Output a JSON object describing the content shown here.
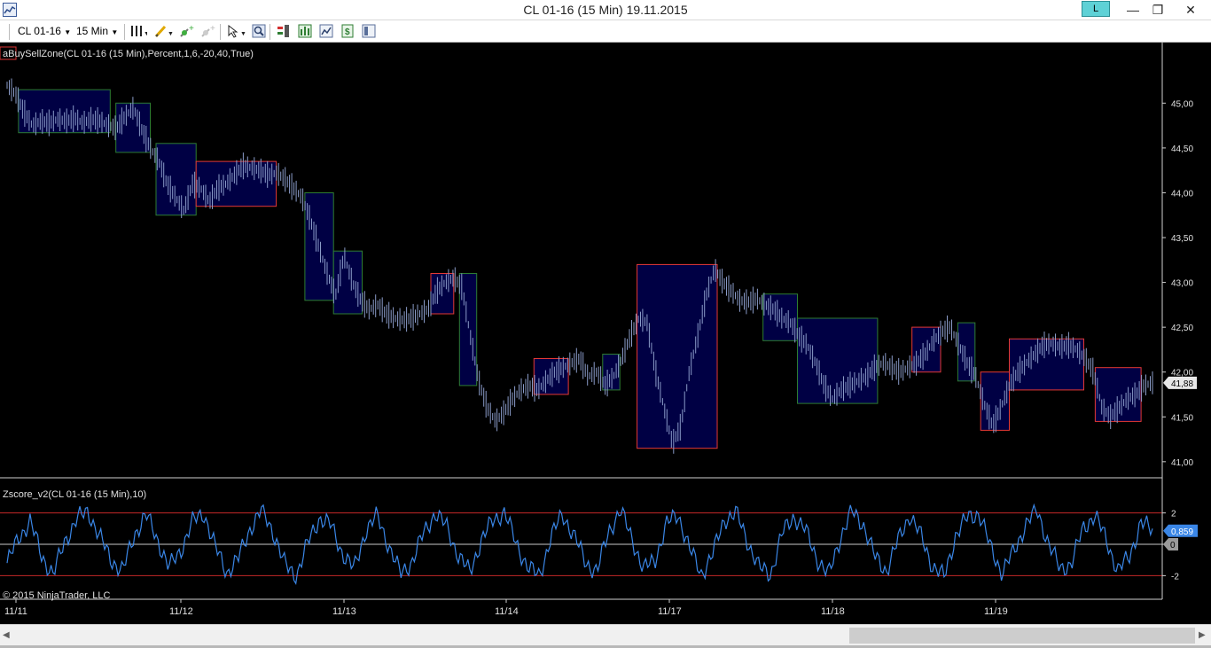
{
  "window": {
    "title": "CL 01-16 (15 Min)  19.11.2015",
    "link_label": "L",
    "minimize": "—",
    "maximize": "❐",
    "close": "✕"
  },
  "toolbar": {
    "instrument": "CL 01-16",
    "period": "15 Min",
    "icons": [
      "bar-style-icon",
      "draw-pencil-icon",
      "add-indicator-icon",
      "strategy-icon",
      "cursor-icon",
      "zoom-icon",
      "chart-trader-icon",
      "data-box-icon",
      "template-icon",
      "order-icon",
      "properties-icon"
    ]
  },
  "chart": {
    "indicator_label": "aBuySellZone(CL 01-16 (15 Min),Percent,1,6,-20,40,True)",
    "oscillator_label": "Zscore_v2(CL 01-16 (15 Min),10)",
    "copyright": "© 2015 NinjaTrader, LLC",
    "colors": {
      "background": "#000000",
      "price_bars": "#8a9bc8",
      "buy_zone": "#2e7d32",
      "sell_zone": "#e53935",
      "zone_fill": "#000050",
      "zscore_line": "#3a86e6",
      "bands": "#c62828"
    }
  },
  "chart_data": [
    {
      "type": "line",
      "title": "",
      "ylim": [
        40.85,
        45.3
      ],
      "y_ticks": [
        "45,00",
        "44,50",
        "44,00",
        "43,50",
        "43,00",
        "42,50",
        "42,00",
        "41,50",
        "41,00"
      ],
      "x_ticks": [
        "11/11",
        "11/12",
        "11/13",
        "11/14",
        "11/17",
        "11/18",
        "11/19"
      ],
      "last_price_label": "41,88",
      "series": [
        {
          "values": [
            45.2,
            45.1,
            44.9,
            44.75,
            44.8,
            44.78,
            44.82,
            44.8,
            44.83,
            44.78,
            44.82,
            44.8,
            44.75,
            44.72,
            44.85,
            44.95,
            44.7,
            44.5,
            44.35,
            44.1,
            43.95,
            43.8,
            44.1,
            44.05,
            43.9,
            44.05,
            44.1,
            44.2,
            44.3,
            44.28,
            44.25,
            44.2,
            44.22,
            44.15,
            44.05,
            43.95,
            43.7,
            43.4,
            43.1,
            42.85,
            43.3,
            43.0,
            42.8,
            42.7,
            42.75,
            42.65,
            42.6,
            42.58,
            42.6,
            42.65,
            42.7,
            42.9,
            43.0,
            43.05,
            42.95,
            42.4,
            41.9,
            41.6,
            41.45,
            41.55,
            41.7,
            41.8,
            41.85,
            41.8,
            41.9,
            42.0,
            42.05,
            42.1,
            42.15,
            41.95,
            42.0,
            41.85,
            41.95,
            42.15,
            42.4,
            42.6,
            42.55,
            42.0,
            41.6,
            41.2,
            41.4,
            42.0,
            42.4,
            42.85,
            43.15,
            43.0,
            42.9,
            42.8,
            42.78,
            42.82,
            42.75,
            42.7,
            42.6,
            42.55,
            42.4,
            42.3,
            42.1,
            41.85,
            41.7,
            41.8,
            41.85,
            41.9,
            41.95,
            42.05,
            42.1,
            42.05,
            42.0,
            42.05,
            42.1,
            42.2,
            42.35,
            42.45,
            42.5,
            42.3,
            42.1,
            41.95,
            41.65,
            41.4,
            41.6,
            41.85,
            42.0,
            42.1,
            42.2,
            42.3,
            42.32,
            42.28,
            42.3,
            42.25,
            42.15,
            42.0,
            41.6,
            41.5,
            41.6,
            41.7,
            41.75,
            41.85,
            41.88
          ]
        }
      ]
    },
    {
      "type": "line",
      "title": "",
      "ylim": [
        -2.6,
        2.6
      ],
      "y_ticks": [
        "2",
        "0",
        "-2"
      ],
      "bands": [
        2,
        0,
        -2
      ],
      "last_value_label": "0,859",
      "zero_label": "0",
      "series": [
        {
          "values": [
            -1.2,
            0.4,
            1.5,
            -0.8,
            -1.9,
            0.2,
            1.6,
            2.1,
            0.5,
            -1.0,
            -1.7,
            0.6,
            1.9,
            0.3,
            -1.5,
            -0.4,
            1.4,
            2.0,
            -0.2,
            -1.8,
            -0.9,
            1.0,
            2.2,
            0.8,
            -1.3,
            -2.0,
            0.1,
            1.7,
            1.2,
            -0.6,
            -1.6,
            0.9,
            1.8,
            -0.1,
            -1.9,
            -1.1,
            0.7,
            2.0,
            1.1,
            -0.7,
            -1.8,
            0.3,
            1.5,
            2.1,
            0.0,
            -1.4,
            -2.1,
            0.5,
            1.9,
            0.6,
            -1.2,
            -1.7,
            0.8,
            2.2,
            0.4,
            -1.6,
            -1.0,
            1.3,
            1.9,
            -0.3,
            -1.9,
            -0.6,
            1.6,
            2.0,
            0.2,
            -1.5,
            -1.9,
            0.7,
            1.8,
            0.9,
            -0.9,
            -2.0,
            0.4,
            2.1,
            1.3,
            -0.8,
            -1.7,
            0.2,
            1.9,
            0.5,
            -1.4,
            -2.1,
            0.6,
            1.7,
            2.0,
            -0.2,
            -1.8,
            -0.5,
            1.2,
            2.2,
            0.1,
            -1.6,
            -1.2,
            1.0,
            1.9,
            0.3,
            -1.7,
            -0.8,
            1.4,
            0.859
          ]
        }
      ]
    }
  ]
}
